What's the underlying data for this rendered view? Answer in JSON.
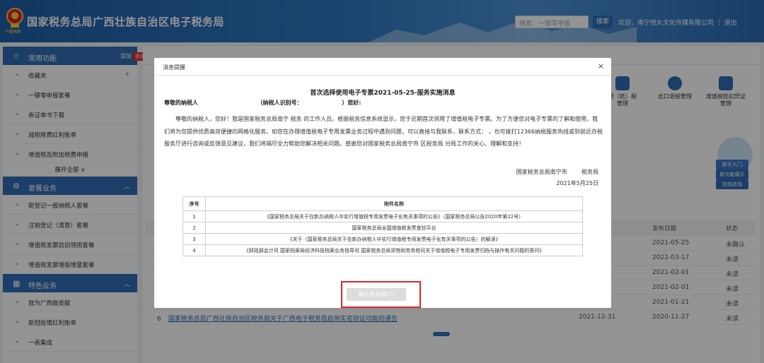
{
  "header": {
    "emblem_text": "中國稅務",
    "site_title": "国家税务总局广西壮族自治区电子税务局",
    "search_placeholder": "搜索：一键零申报",
    "search_button": "搜索",
    "welcome": "欢迎，南宁悦丸文化传媒有限公司 ｜ 退出"
  },
  "sidebar": {
    "common": {
      "label": "常用功能",
      "add": "添加",
      "badge": "信用"
    },
    "common_items": [
      "收藏夹",
      "一键零申报套餐",
      "表证单书下载",
      "减税降费红利账单",
      "增值税及附加税费申报"
    ],
    "expand_all": "展开全部 ∨",
    "package": {
      "label": "套餐业务"
    },
    "package_items": [
      "新登记一般纳税人套餐",
      "注销登记（清算）套餐",
      "增值税发票验旧领用套餐",
      "增值税发票增版增量套餐"
    ],
    "feature": {
      "label": "特色业务"
    },
    "feature_items": [
      "我为广西做贡献",
      "新冠疫情红利账单",
      "一表集成"
    ]
  },
  "background": {
    "icons": [
      {
        "label": "退（抵）税\n管理"
      },
      {
        "label": "出口退税管理"
      },
      {
        "label": "增值税抵扣凭证\n管理"
      }
    ],
    "side_buttons": [
      "新手入门",
      "新功能展示",
      "在线咨询"
    ],
    "table_head": {
      "pub": "发布日期",
      "status": "状态"
    },
    "rows": [
      {
        "date": "2021-05-25",
        "status": "未确认"
      },
      {
        "date": "2021-03-17",
        "status": "未读"
      },
      {
        "date": "2021-02-01",
        "status": "未读"
      },
      {
        "date": "2021-02-01",
        "status": "未读"
      },
      {
        "date": "2021-01-21",
        "status": "未读"
      },
      {
        "no": "6",
        "title": "国家税务总局广西壮族自治区税务局关于广西电子税务局启用实名验证功能的通告",
        "deadline": "2021-12-31",
        "date": "2020-11-27",
        "status": "未读"
      }
    ]
  },
  "modal": {
    "title": "消息提醒",
    "close": "×",
    "msg_title": "首次选择使用电子专票2021-05-25-服务实施消息",
    "greet": "尊敬的纳税人                              （纳税人识别号：                    ）您好:",
    "body": "尊敬的纳税人，您好！我是国家税务总局南宁          税务          的工作人员。根据税务信息系统显示，您于近期首次领用了增值税电子专票。为了方便您对电子专票的了解和使用，我们将为您提供优质高效便捷的网格化服务。如您在办理增值税电子专用发票业务过程中遇到问题，可以直接与我联系，联系方式：            ，也可拨打12366纳税服务热线或到就近办税服务厅进行咨询或反馈意见建议，我们将竭尽全力帮助您解决相关问题。感谢您对国家税务总局南宁市        区税务局        分局工作的关心、理解和支持！",
    "sign_org": "国家税务总局南宁市        税务局",
    "sign_date": "2021年5月25日",
    "table_head": {
      "no": "序号",
      "name": "附件名称"
    },
    "attachments": [
      {
        "no": "1",
        "name": "《国家税务总局关于在新办纳税人中实行增值税专用发票电子化有关事项的公告》（国家税务总局公告2020年第22号）"
      },
      {
        "no": "2",
        "name": "国家税务总局全国增值税发票查验平台"
      },
      {
        "no": "3",
        "name": "《关于〈国家税务总局关于在新办纳税人中实行增值税专用发票电子化有关事项的公告〉的解读》"
      },
      {
        "no": "4",
        "name": "《财政部会计司 国家档案局经济科技档案业务指导司 国家税务总局货物和劳务税司关于增值税电子专用发票归档与操作有关问题的答问》"
      }
    ],
    "confirm": "确认并关闭(7)"
  }
}
